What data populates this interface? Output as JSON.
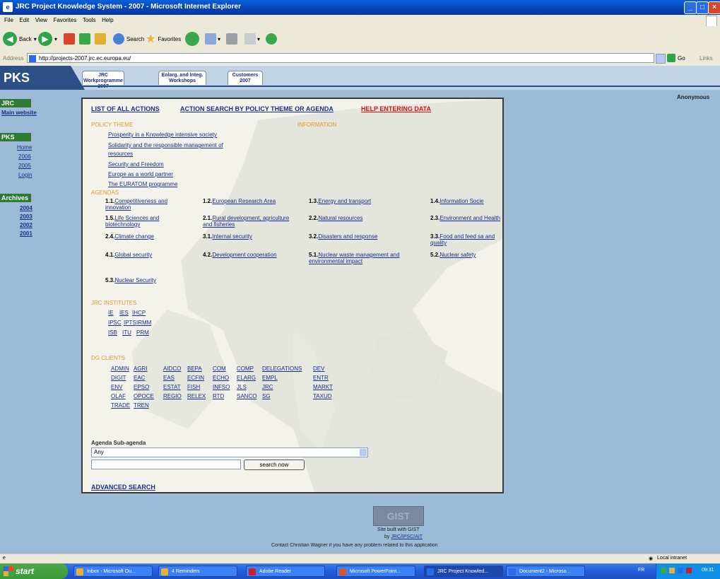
{
  "window": {
    "title": "JRC Project Knowledge System - 2007 - Microsoft Internet Explorer"
  },
  "menu": [
    "File",
    "Edit",
    "View",
    "Favorites",
    "Tools",
    "Help"
  ],
  "toolbar": {
    "back": "Back",
    "search": "Search",
    "favorites": "Favorites"
  },
  "address": {
    "label": "Address",
    "url": "http://projects-2007.jrc.ec.europa.eu/",
    "go": "Go",
    "links": "Links"
  },
  "header": {
    "logo": "PKS",
    "tabs": [
      {
        "line1": "JRC Workprogramme",
        "line2": "2007"
      },
      {
        "line1": "Enlarg. and Integ.",
        "line2": "Workshops"
      },
      {
        "line1": "Customers",
        "line2": "2007"
      }
    ],
    "user": "Anonymous"
  },
  "sidebar": {
    "jrc_head": "JRC",
    "jrc_link": "Main website",
    "pks_head": "PKS",
    "pks_items": [
      "Home",
      "2006",
      "2005",
      "Login"
    ],
    "archives_head": "Archives",
    "archives_items": [
      "2004",
      "2003",
      "2002",
      "2001"
    ]
  },
  "main": {
    "top_links": [
      "LIST OF ALL ACTIONS",
      "ACTION SEARCH BY POLICY THEME OR AGENDA",
      "HELP ENTERING DATA"
    ],
    "policy_title": "POLICY THEME",
    "info_title": "INFORMATION",
    "policies": [
      "Prosperity in a Knowledge intensive society",
      "Solidarity and the responsible management of",
      "resources",
      "Security and Freedom",
      "Europe as a world partner",
      "The EURATOM programme"
    ],
    "agendas_title": "AGENDAS",
    "agendas": [
      {
        "num": "1.1.",
        "text": "Competitiveness and innovation"
      },
      {
        "num": "1.2.",
        "text": "European Research Area"
      },
      {
        "num": "1.3.",
        "text": "Energy and transport"
      },
      {
        "num": "1.4.",
        "text": "Information Socie"
      },
      {
        "num": "1.5.",
        "text": "Life Sciences and biotechnology"
      },
      {
        "num": "2.1.",
        "text": "Rural development, agriculture and fisheries"
      },
      {
        "num": "2.2.",
        "text": "Natural resources"
      },
      {
        "num": "2.3.",
        "text": "Environment and Health"
      },
      {
        "num": "2.4.",
        "text": "Climate change"
      },
      {
        "num": "3.1.",
        "text": "Internal security"
      },
      {
        "num": "3.2.",
        "text": "Disasters and response"
      },
      {
        "num": "3.3.",
        "text": "Food and feed sa and quality"
      },
      {
        "num": "4.1.",
        "text": "Global security"
      },
      {
        "num": "4.2.",
        "text": "Development cooperation"
      },
      {
        "num": "5.1.",
        "text": "Nuclear waste management and environmental impact"
      },
      {
        "num": "5.2.",
        "text": "Nuclear safety"
      },
      {
        "num": "5.3.",
        "text": "Nuclear Security"
      }
    ],
    "institutes_title": "JRC INSTITUTES",
    "institutes": [
      "IE",
      "IES",
      "IHCP",
      "IPSC",
      "IPTS",
      "IRMM",
      "ISB",
      "ITU",
      "PRM"
    ],
    "clients_title": "DG CLIENTS",
    "clients": [
      [
        "ADMIN",
        "AGRI",
        "AIDCO",
        "BEPA",
        "COM",
        "COMP",
        "DELEGATIONS",
        "DEV"
      ],
      [
        "DIGIT",
        "EAC",
        "EAS",
        "ECFIN",
        "ECHO",
        "ELARG",
        "EMPL",
        "ENTR"
      ],
      [
        "ENV",
        "EPSO",
        "ESTAT",
        "FISH",
        "INFSO",
        "JLS",
        "JRC",
        "MARKT"
      ],
      [
        "OLAF",
        "OPOCE",
        "REGIO",
        "RELEX",
        "RTD",
        "SANCO",
        "SG",
        "TAXUD"
      ],
      [
        "TRADE",
        "TREN"
      ]
    ],
    "agenda_label": "Agenda Sub-agenda",
    "agenda_select": "Any",
    "search_button": "search now",
    "advanced": "ADVANCED SEARCH"
  },
  "footer": {
    "logo": "GIST",
    "built": "Site built with GIST",
    "by": "by",
    "by_link": "JRC/IPSC/AIT",
    "contact": "Contact Christian Wagner if you have any problem related to this application"
  },
  "status": {
    "zone": "Local intranet"
  },
  "taskbar": {
    "start": "start",
    "tasks": [
      {
        "label": "Inbox - Microsoft Ou...",
        "color": "#e8b23a"
      },
      {
        "label": "4 Reminders",
        "color": "#e8b23a"
      },
      {
        "label": "Adobe Reader",
        "color": "#c8202a"
      },
      {
        "label": "Microsoft PowerPoint...",
        "color": "#d8562a"
      },
      {
        "label": "JRC Project Knowled...",
        "color": "#2a6be6"
      },
      {
        "label": "Document2 - Microso...",
        "color": "#2a6be6"
      }
    ],
    "lang": "FR",
    "clock": "09:31"
  }
}
